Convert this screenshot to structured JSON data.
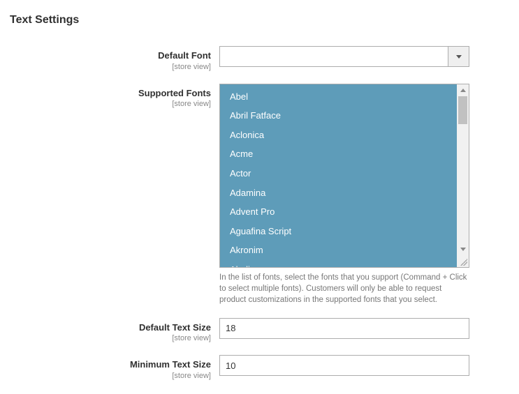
{
  "section_title": "Text Settings",
  "scope_text": "[store view]",
  "fields": {
    "default_font": {
      "label": "Default Font",
      "value": ""
    },
    "supported_fonts": {
      "label": "Supported Fonts",
      "options": [
        "Abel",
        "Abril Fatface",
        "Aclonica",
        "Acme",
        "Actor",
        "Adamina",
        "Advent Pro",
        "Aguafina Script",
        "Akronim",
        "Aladin"
      ],
      "help": "In the list of fonts, select the fonts that you support (Command + Click to select multiple fonts). Customers will only be able to request product customizations in the supported fonts that you select."
    },
    "default_text_size": {
      "label": "Default Text Size",
      "value": "18"
    },
    "minimum_text_size": {
      "label": "Minimum Text Size",
      "value": "10"
    }
  }
}
